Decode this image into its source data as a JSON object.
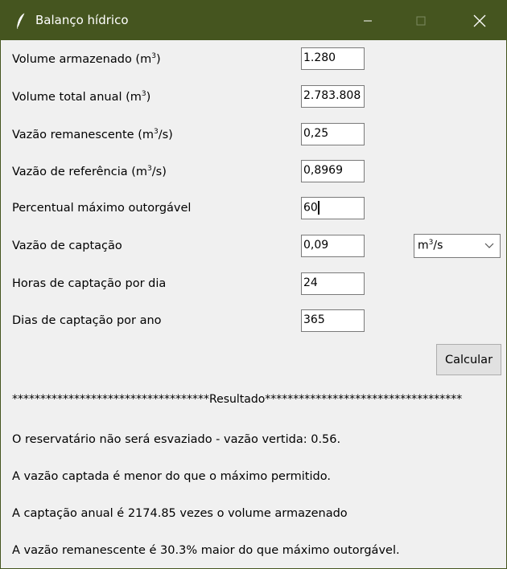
{
  "window": {
    "title": "Balanço hídrico",
    "icon": "feather-icon",
    "controls": [
      "minimize-icon",
      "maximize-icon",
      "close-icon"
    ]
  },
  "form": {
    "fields": [
      {
        "label_pre": "Volume armazenado (m",
        "label_sup": "3",
        "label_post": ")",
        "value": "1.280"
      },
      {
        "label_pre": "Volume total anual (m",
        "label_sup": "3",
        "label_post": ")",
        "value": "2.783.808"
      },
      {
        "label_pre": "Vazão remanescente (m",
        "label_sup": "3",
        "label_post": "/s)",
        "value": "0,25"
      },
      {
        "label_pre": "Vazão de referência (m",
        "label_sup": "3",
        "label_post": "/s)",
        "value": "0,8969"
      },
      {
        "label_pre": "Percentual máximo outorgável",
        "label_sup": "",
        "label_post": "",
        "value": "60"
      },
      {
        "label_pre": "Vazão de captação",
        "label_sup": "",
        "label_post": "",
        "value": "0,09"
      },
      {
        "label_pre": "Horas de captação por dia",
        "label_sup": "",
        "label_post": "",
        "value": "24"
      },
      {
        "label_pre": "Dias de captação por ano",
        "label_sup": "",
        "label_post": "",
        "value": "365"
      }
    ],
    "unit_select": {
      "pre": "m",
      "sup": "3",
      "post": "/s"
    },
    "calc_button": "Calcular"
  },
  "result": {
    "separator": "***********************************Resultado***********************************",
    "lines": [
      "O reservatário não será esvaziado - vazão vertida: 0.56.",
      "A vazão captada é menor do que o máximo permitido.",
      "A captação anual é 2174.85 vezes o volume armazenado",
      "A vazão remanescente é 30.3% maior do que máximo outorgável."
    ]
  },
  "colors": {
    "titlebar": "#45551f",
    "background": "#f0f0f0"
  }
}
